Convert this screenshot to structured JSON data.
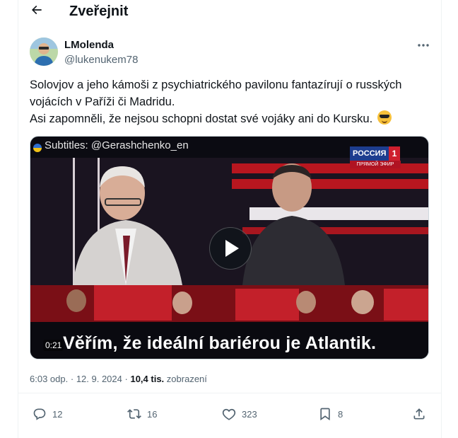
{
  "header": {
    "title": "Zveřejnit"
  },
  "author": {
    "name": "LMolenda",
    "handle": "@lukenukem78"
  },
  "tweet": {
    "lines": [
      "Solovjov a jeho kámoši z psychiatrického pavilonu fantazírují o rusských",
      "vojácích v Paříži či Madridu.",
      "Asi zapomněli, že nejsou schopni dostat své vojáky ani do Kursku."
    ]
  },
  "video": {
    "subtitle_credit": "Subtitles: @Gerashchenko_en",
    "channel": "РОССИЯ",
    "channel_num": "1",
    "live": "ПРЯМОЙ ЭФИР",
    "caption": "Věřím, že ideální bariérou je Atlantik.",
    "duration": "0:21"
  },
  "meta": {
    "time": "6:03 odp.",
    "dot": "·",
    "date": "12. 9. 2024",
    "dot2": "·",
    "views": "10,4 tis.",
    "views_label": "zobrazení"
  },
  "actions": {
    "replies": "12",
    "retweets": "16",
    "likes": "323",
    "bookmarks": "8"
  },
  "colors": {
    "text": "#0f1419",
    "secondary": "#536471",
    "border": "#eff3f4"
  }
}
